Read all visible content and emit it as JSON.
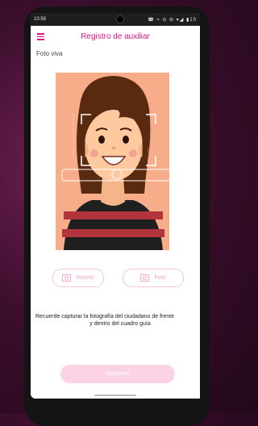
{
  "status_bar": {
    "time": "10:58",
    "icons": "☎ ≈ ⊙ ⊖ ▾◢ ▮10"
  },
  "app_bar": {
    "title": "Registro de auxiliar",
    "menu_icon": "hamburger-icon"
  },
  "section": {
    "label": "Foto viva"
  },
  "buttons": {
    "retry_label": "Repetir",
    "photo_label": "Foto",
    "next_label": "Siguiente"
  },
  "instruction": {
    "line1": "Recuerde capturar la fotografía del ciudadano de frente",
    "line2": "y dentro del cuadro guía"
  },
  "colors": {
    "accent": "#e0157f",
    "button_disabled": "#fbd3e4",
    "photo_bg": "#f7ad8a"
  }
}
